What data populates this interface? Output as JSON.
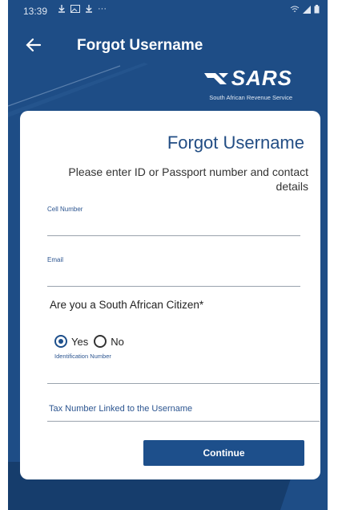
{
  "status_bar": {
    "time": "13:39",
    "more": "···"
  },
  "app_bar": {
    "title": "Forgot Username"
  },
  "brand": {
    "name": "SARS",
    "subtitle": "South African Revenue Service"
  },
  "form": {
    "title": "Forgot Username",
    "subtitle": "Please enter ID or Passport number and contact details",
    "cell_label": "Cell Number",
    "cell_value": "",
    "email_label": "Email",
    "email_value": "",
    "citizen_question": "Are you a South African Citizen*",
    "radio_options": [
      {
        "label": "Yes",
        "checked": true
      },
      {
        "label": "No",
        "checked": false
      }
    ],
    "id_label": "Identification Number",
    "tax_label": "Tax Number Linked to the Username",
    "continue_label": "Continue"
  },
  "colors": {
    "brand_blue": "#1e4d86",
    "button_blue": "#1d4f8b",
    "card": "#ffffff"
  }
}
